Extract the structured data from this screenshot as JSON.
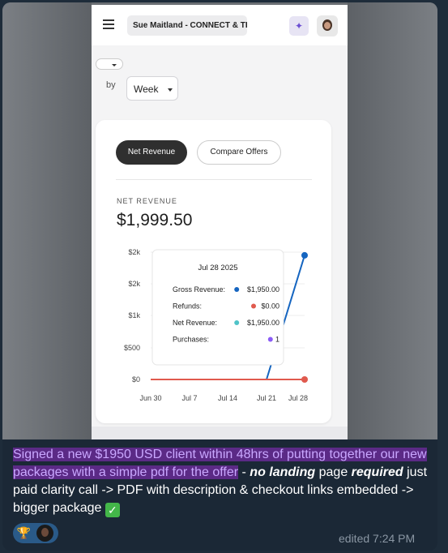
{
  "app": {
    "account_label": "Sue Maitland - CONNECT & TH...",
    "small_select_value": "",
    "by_label": "by",
    "period_select": "Week"
  },
  "tabs": [
    {
      "label": "Net Revenue",
      "active": true
    },
    {
      "label": "Compare Offers",
      "active": false
    }
  ],
  "metric": {
    "label": "NET REVENUE",
    "value": "$1,999.50"
  },
  "chart_data": {
    "type": "line",
    "x": [
      "Jun 30",
      "Jul 7",
      "Jul 14",
      "Jul 21",
      "Jul 28"
    ],
    "y_tick_labels": [
      "$0",
      "$500",
      "$1k",
      "$2k",
      "$2k"
    ],
    "series": [
      {
        "name": "Gross Revenue",
        "color": "#1565c0",
        "values": [
          0,
          0,
          0,
          0,
          1950
        ]
      },
      {
        "name": "Refunds",
        "color": "#e05a4e",
        "values": [
          0,
          0,
          0,
          0,
          0
        ]
      }
    ],
    "ylim": [
      0,
      2000
    ],
    "grid": true,
    "tooltip": {
      "title": "Jul 28 2025",
      "rows": [
        {
          "label": "Gross Revenue:",
          "value": "$1,950.00",
          "color": "#1565c0"
        },
        {
          "label": "Refunds:",
          "value": "$0.00",
          "color": "#e05a4e"
        },
        {
          "label": "Net Revenue:",
          "value": "$1,950.00",
          "color": "#4fc3c8"
        },
        {
          "label": "Purchases:",
          "value": "1",
          "color": "#8b5cf6"
        }
      ]
    }
  },
  "message": {
    "highlight": "Signed a new $1950 USD client within 48hrs of putting together our new packages with a simple pdf for the offer",
    "dash": " - ",
    "bold_italic_1": "no landing",
    "text_1": " page ",
    "bold_italic_2": "required",
    "text_2": " just paid clarity call -> PDF with description & checkout links embedded -> bigger package ",
    "check": "✓",
    "meta": "edited 7:24 PM",
    "reaction_emoji": "🏆"
  }
}
